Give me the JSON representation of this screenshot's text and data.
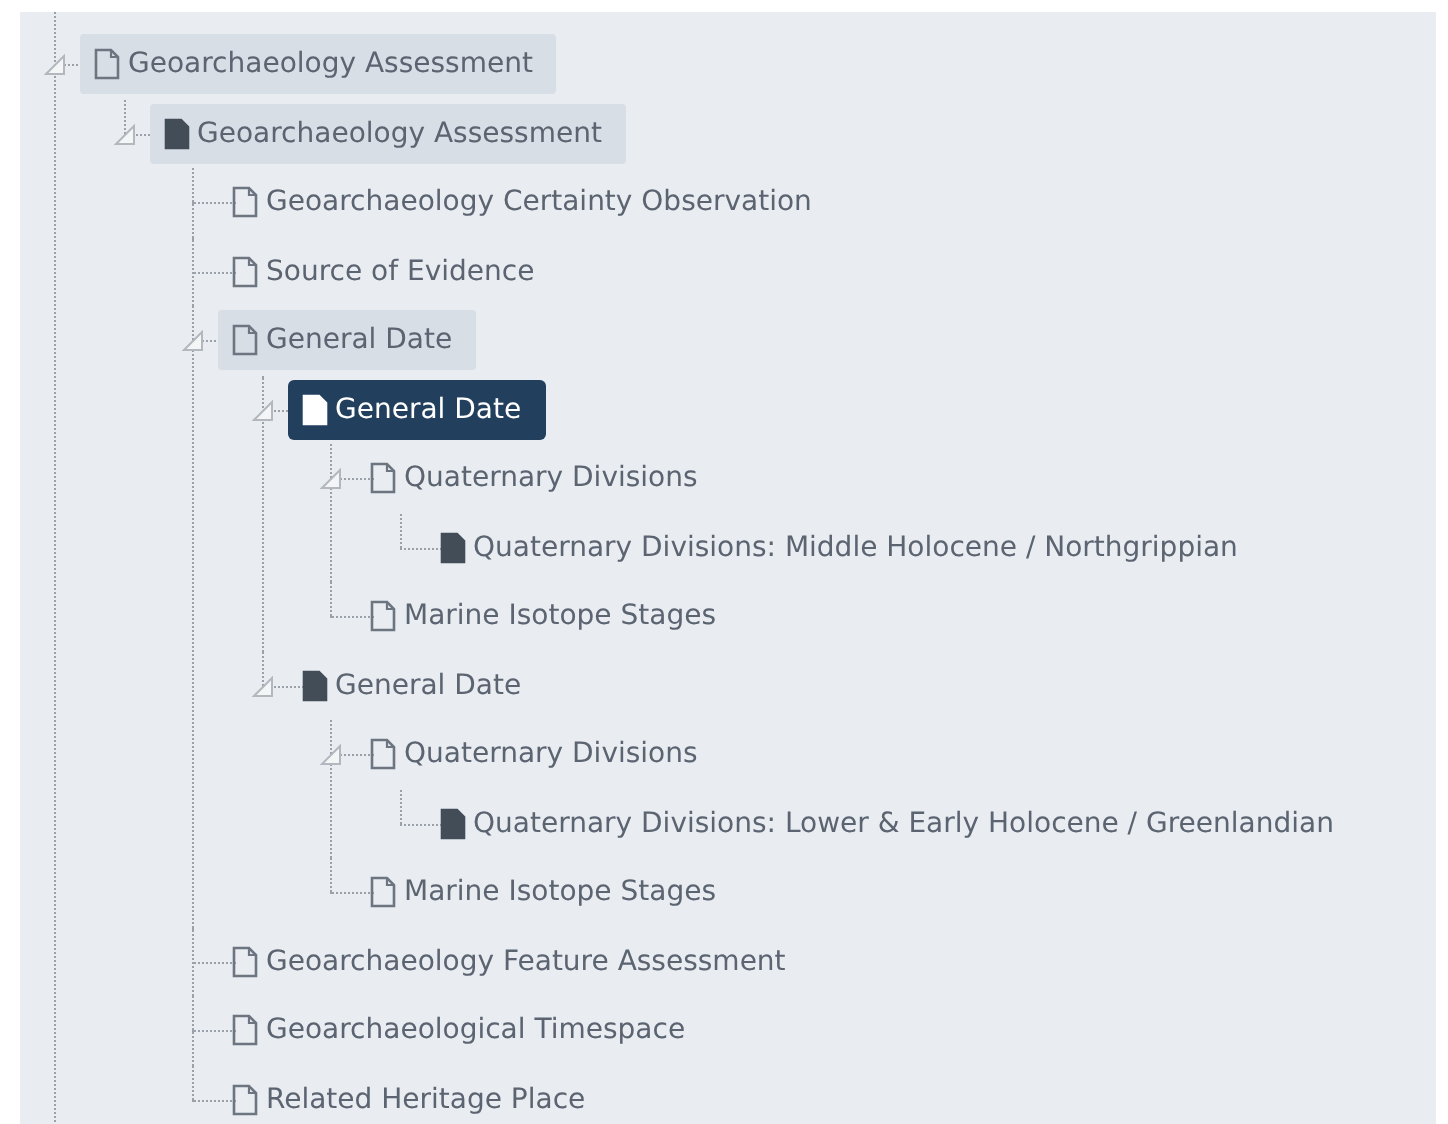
{
  "tree": [
    {
      "label": "Geoarchaeology Assessment",
      "kind": "outline",
      "highlighted": true,
      "selected": false,
      "expanded": true,
      "children": [
        {
          "label": "Geoarchaeology Assessment",
          "kind": "filled",
          "highlighted": true,
          "selected": false,
          "expanded": true,
          "children": [
            {
              "label": "Geoarchaeology Certainty Observation",
              "kind": "outline",
              "highlighted": false,
              "selected": false
            },
            {
              "label": "Source of Evidence",
              "kind": "outline",
              "highlighted": false,
              "selected": false
            },
            {
              "label": "General Date",
              "kind": "outline",
              "highlighted": true,
              "selected": false,
              "expanded": true,
              "children": [
                {
                  "label": "General Date",
                  "kind": "filled",
                  "selected": true,
                  "expanded": true,
                  "children": [
                    {
                      "label": "Quaternary Divisions",
                      "kind": "outline",
                      "highlighted": false,
                      "selected": false,
                      "expanded": true,
                      "children": [
                        {
                          "label": "Quaternary Divisions: Middle Holocene / Northgrippian",
                          "kind": "filled",
                          "highlighted": false,
                          "selected": false
                        }
                      ]
                    },
                    {
                      "label": "Marine Isotope Stages",
                      "kind": "outline",
                      "highlighted": false,
                      "selected": false
                    }
                  ]
                },
                {
                  "label": "General Date",
                  "kind": "filled",
                  "highlighted": false,
                  "selected": false,
                  "expanded": true,
                  "children": [
                    {
                      "label": "Quaternary Divisions",
                      "kind": "outline",
                      "highlighted": false,
                      "selected": false,
                      "expanded": true,
                      "children": [
                        {
                          "label": "Quaternary Divisions: Lower & Early Holocene / Greenlandian",
                          "kind": "filled",
                          "highlighted": false,
                          "selected": false
                        }
                      ]
                    },
                    {
                      "label": "Marine Isotope Stages",
                      "kind": "outline",
                      "highlighted": false,
                      "selected": false
                    }
                  ]
                }
              ]
            },
            {
              "label": "Geoarchaeology Feature Assessment",
              "kind": "outline",
              "highlighted": false,
              "selected": false
            },
            {
              "label": "Geoarchaeological Timespace",
              "kind": "outline",
              "highlighted": false,
              "selected": false
            },
            {
              "label": "Related Heritage Place",
              "kind": "outline",
              "highlighted": false,
              "selected": false
            }
          ]
        }
      ]
    }
  ]
}
